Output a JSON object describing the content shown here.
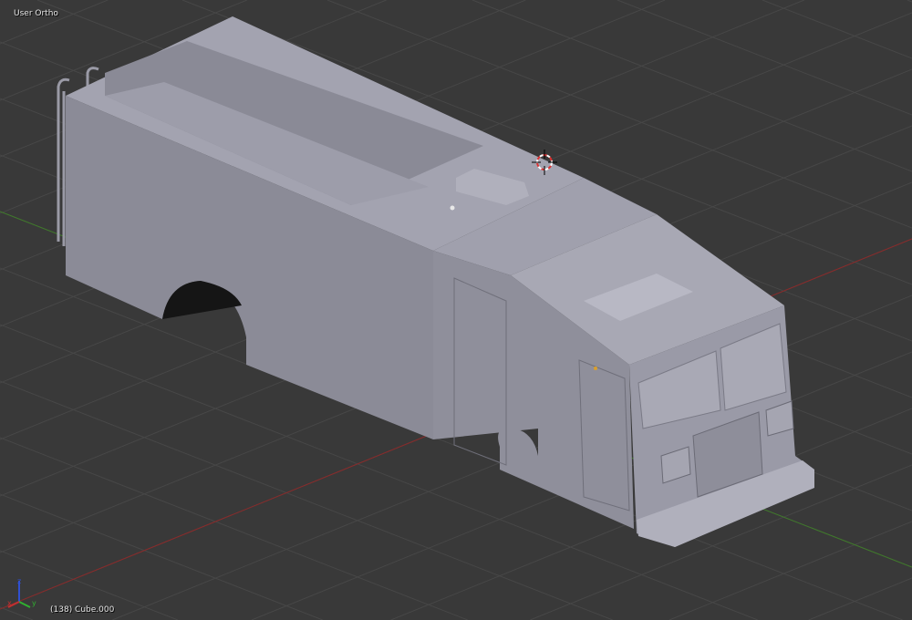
{
  "viewport": {
    "view_name": "User Ortho",
    "object_info": "(138) Cube.000",
    "axis_labels": {
      "x": "x",
      "y": "y",
      "z": "z"
    }
  },
  "colors": {
    "background": "#393939",
    "grid": "#474747",
    "x_axis": "#8a2a2a",
    "y_axis": "#3f7a2a",
    "mesh_side": "#8b8b97",
    "mesh_top": "#a3a3b0",
    "mesh_front": "#9a9aa7"
  }
}
